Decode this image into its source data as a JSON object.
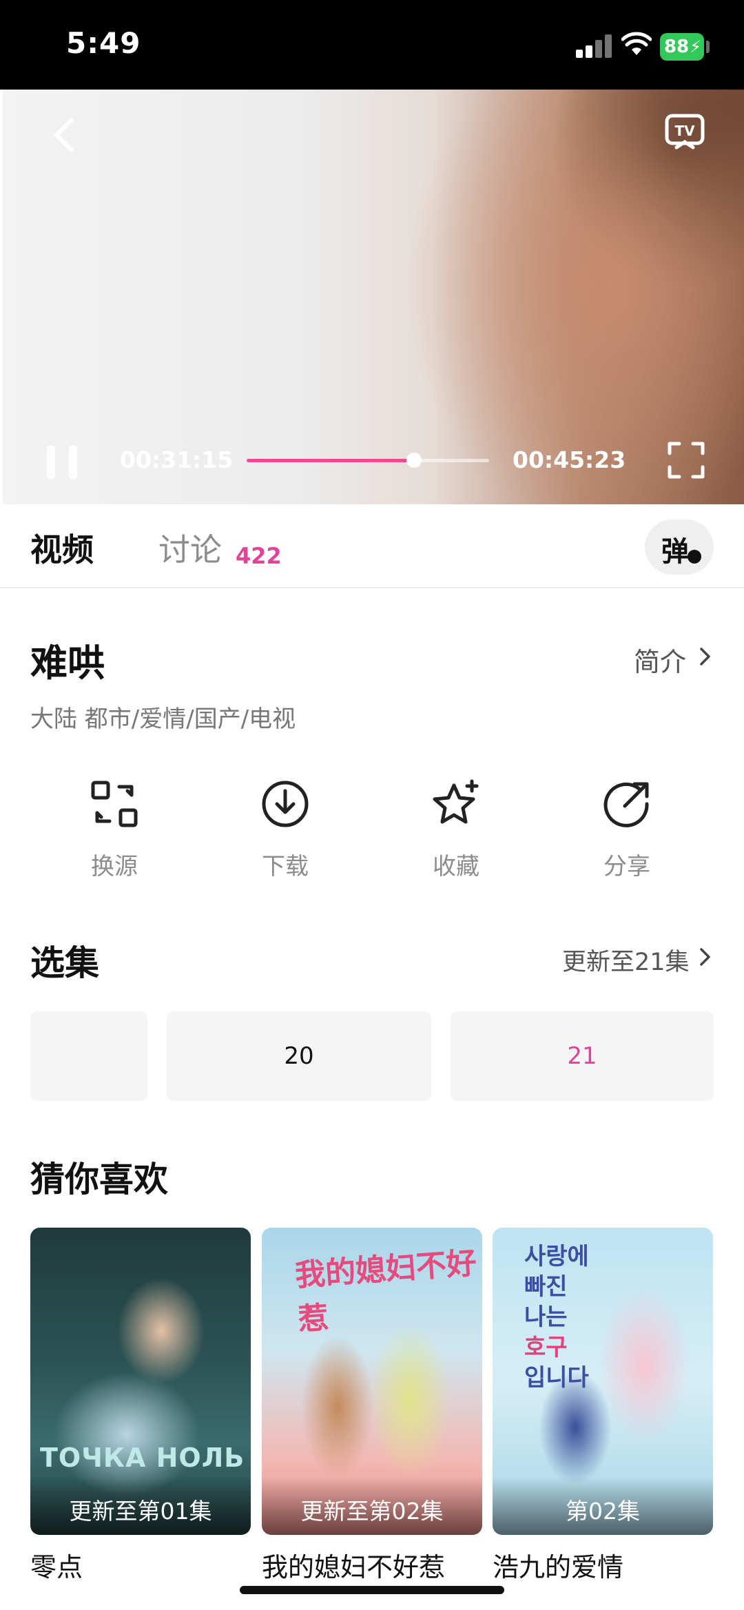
{
  "status_bar": {
    "time": "5:49",
    "battery": "88"
  },
  "player": {
    "current_time": "00:31:15",
    "total_time": "00:45:23",
    "progress": 0.69
  },
  "tabs": {
    "video": "视频",
    "discussion": "讨论",
    "discussion_count": "422",
    "danmaku": "弹"
  },
  "show": {
    "title": "难哄",
    "intro_link": "简介",
    "meta": "大陆  都市/爱情/国产/电视"
  },
  "actions": [
    {
      "label": "换源",
      "icon": "switch-source-icon"
    },
    {
      "label": "下载",
      "icon": "download-icon"
    },
    {
      "label": "收藏",
      "icon": "favorite-star-icon"
    },
    {
      "label": "分享",
      "icon": "share-icon"
    }
  ],
  "episodes": {
    "title": "选集",
    "update_text": "更新至21集",
    "items": [
      {
        "label": ""
      },
      {
        "label": "20"
      },
      {
        "label": "21",
        "active": true
      }
    ],
    "active_color": "#e0439a"
  },
  "recommendations": {
    "title": "猜你喜欢",
    "items": [
      {
        "name": "零点",
        "badge": "更新至第01集",
        "poster_text": "ТОЧКА НОЛЬ"
      },
      {
        "name": "我的媳妇不好惹",
        "badge": "更新至第02集",
        "poster_text": "我的媳妇不好惹"
      },
      {
        "name": "浩九的爱情",
        "badge": "第02集",
        "poster_text_1": "사랑에",
        "poster_text_2": "빠진",
        "poster_text_3": "나는",
        "poster_text_4": "호구",
        "poster_text_5": "입니다"
      }
    ]
  },
  "colors": {
    "accent": "#e0439a",
    "progress": "#ee4a93",
    "battery": "#34c759"
  }
}
